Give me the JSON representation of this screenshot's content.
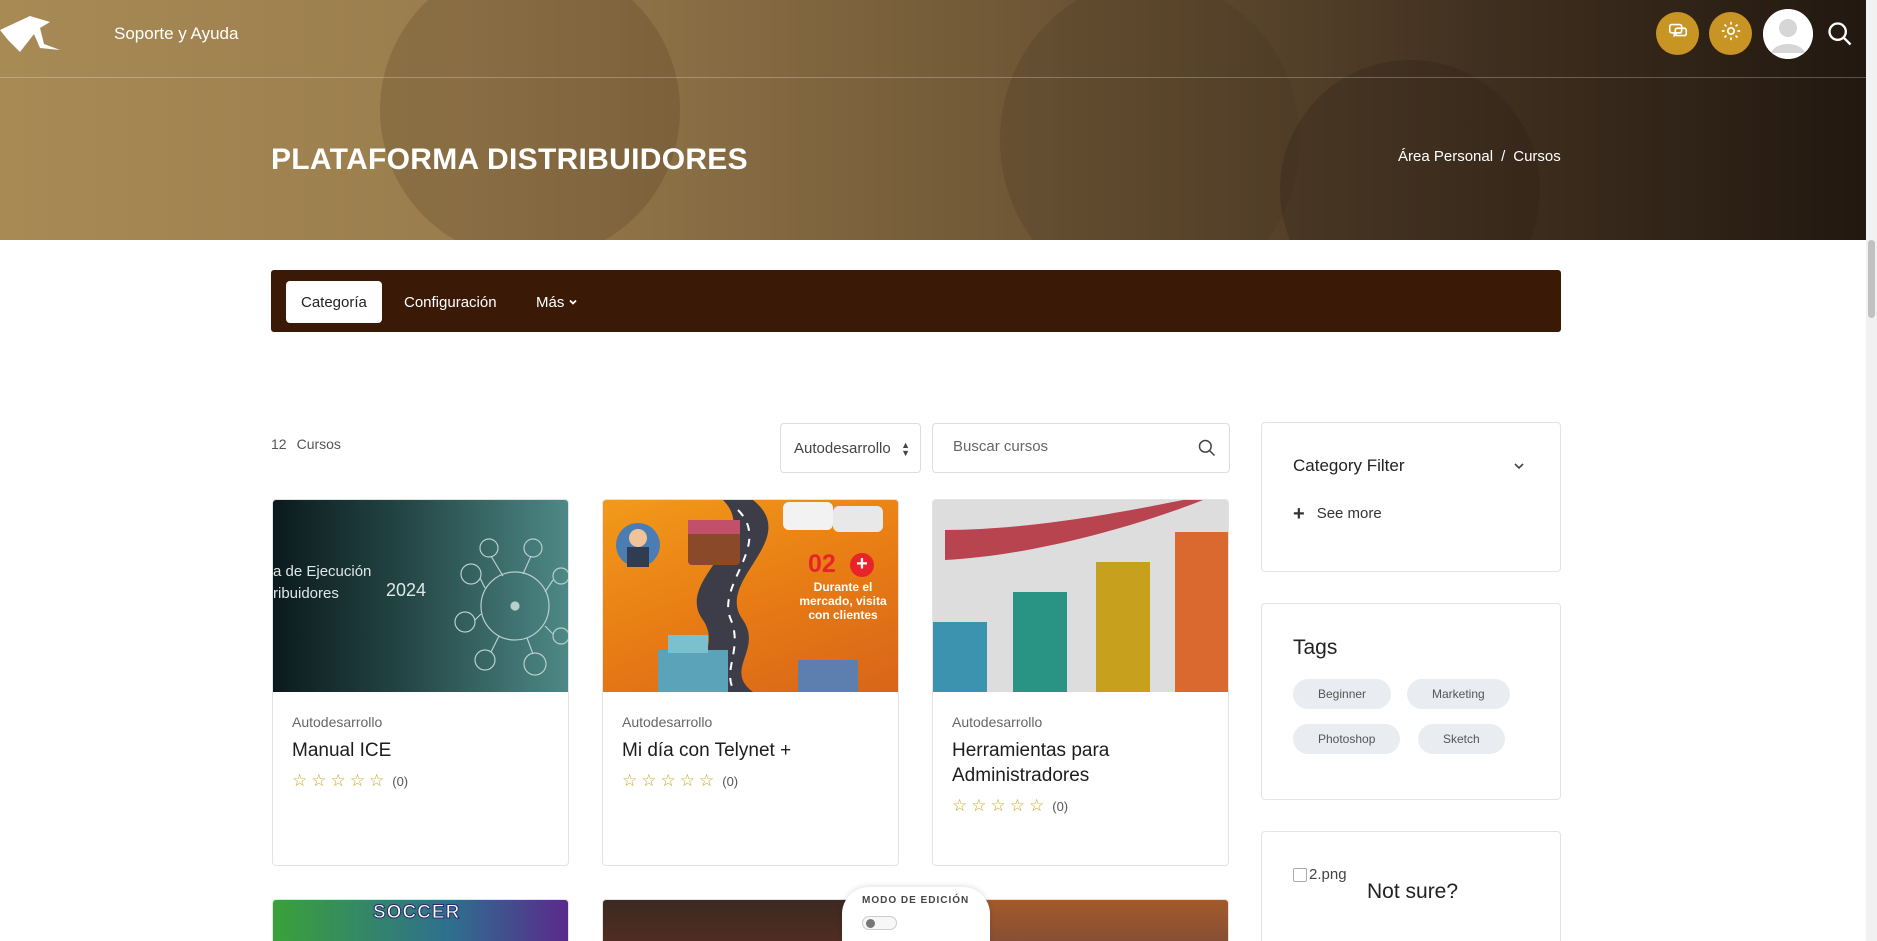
{
  "header": {
    "nav_link": "Soporte y Ayuda",
    "page_title": "PLATAFORMA DISTRIBUIDORES",
    "breadcrumb": [
      "Área Personal",
      "/",
      "Cursos"
    ]
  },
  "secondary_nav": {
    "tabs": [
      "Categoría",
      "Configuración",
      "Más"
    ],
    "active_tab": "Categoría"
  },
  "courses_toolbar": {
    "count": "12",
    "count_label": "Cursos",
    "sort_value": "Autodesarrollo",
    "search_placeholder": "Buscar cursos"
  },
  "courses": [
    {
      "category": "Autodesarrollo",
      "title": "Manual ICE",
      "rating_count": "(0)",
      "thumb_text_line1": "a de Ejecución",
      "thumb_text_line2": "ribuidores",
      "thumb_year": "2024"
    },
    {
      "category": "Autodesarrollo",
      "title": "Mi día con Telynet +",
      "rating_count": "(0)",
      "thumb_number": "02",
      "thumb_text": "Durante el mercado, visita con clientes"
    },
    {
      "category": "Autodesarrollo",
      "title": "Herramientas para Administradores",
      "rating_count": "(0)"
    }
  ],
  "row2_thumb_label": "SOCCER",
  "sidebar": {
    "category_filter": {
      "title": "Category Filter",
      "see_more": "See more"
    },
    "tags": {
      "title": "Tags",
      "items": [
        "Beginner",
        "Marketing",
        "Photoshop",
        "Sketch"
      ]
    },
    "not_sure": {
      "img_alt": "2.png",
      "title": "Not sure?"
    }
  },
  "edit_mode": {
    "label": "MODO DE EDICIÓN",
    "enabled": false
  },
  "colors": {
    "brand_dark": "#3a1a07",
    "accent_gold": "#c89424",
    "star": "#c5a51e"
  },
  "icons": [
    "logo-icon",
    "chat-icon",
    "gear-icon",
    "avatar",
    "search-icon",
    "chevron-down-icon",
    "plus-icon",
    "star-icon"
  ]
}
